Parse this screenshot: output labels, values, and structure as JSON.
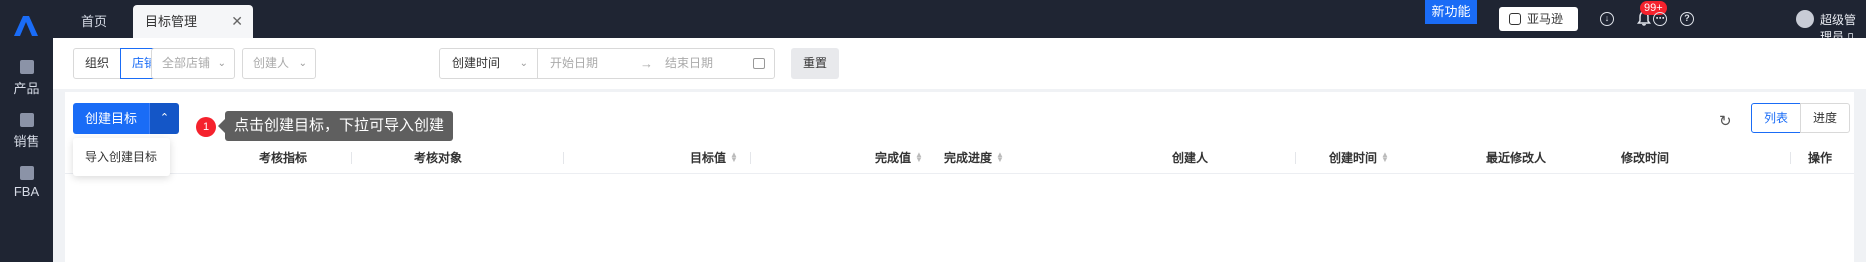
{
  "rail": {
    "items": [
      {
        "label": "产品",
        "icon": "product-icon"
      },
      {
        "label": "销售",
        "icon": "sales-icon"
      },
      {
        "label": "FBA",
        "icon": "fba-icon"
      }
    ]
  },
  "topbar": {
    "tabs": [
      {
        "label": "首页"
      },
      {
        "label": "目标管理"
      }
    ],
    "close_glyph": "✕",
    "new_feature": "新功能",
    "platform": "亚马逊",
    "badge": "99+",
    "user": "超级管理员 ▯"
  },
  "filters": {
    "seg_org": "组织",
    "seg_shop": "店铺",
    "all_shops": "全部店铺",
    "creator": "创建人",
    "date_type": "创建时间",
    "start_date": "开始日期",
    "end_date": "结束日期",
    "arrow": "→",
    "reset": "重置"
  },
  "toolbar": {
    "create": "创建目标",
    "caret": "⌃",
    "dropdown_item": "导入创建目标",
    "step_number": "1",
    "tooltip": "点击创建目标，下拉可导入创建",
    "refresh": "↻",
    "view_list": "列表",
    "view_progress": "进度"
  },
  "table": {
    "columns": [
      "考核指标",
      "考核对象",
      "目标值",
      "完成值",
      "完成进度",
      "创建人",
      "创建时间",
      "最近修改人",
      "修改时间",
      "操作"
    ]
  },
  "colors": {
    "primary": "#1a6cf6",
    "dark_bg": "#1f2533",
    "badge_red": "#f5222d"
  }
}
